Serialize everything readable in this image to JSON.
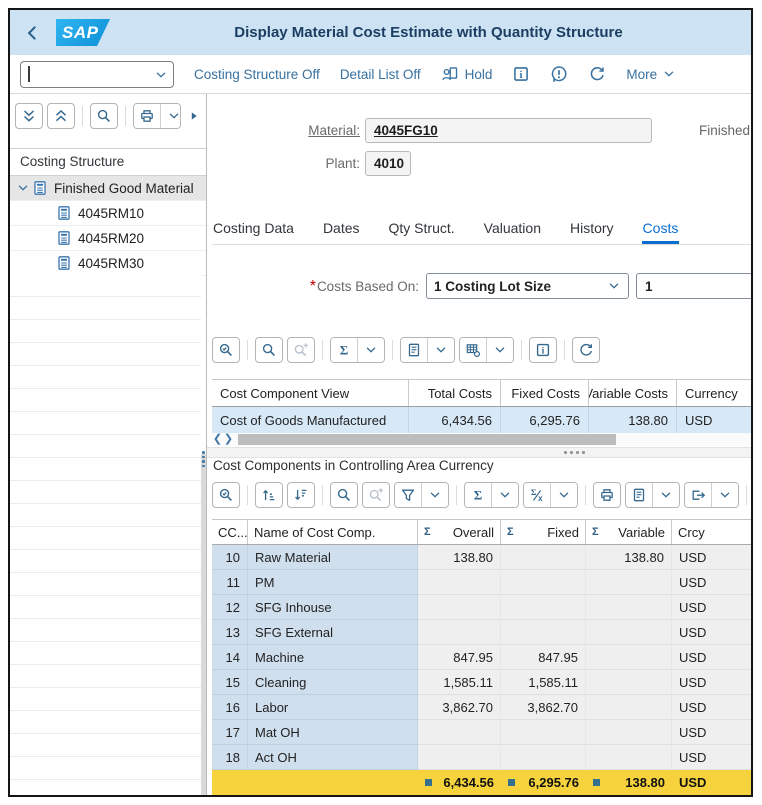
{
  "header": {
    "logo": "SAP",
    "title": "Display Material Cost Estimate with Quantity Structure"
  },
  "shell_toolbar": {
    "command_value": "",
    "costing_structure_btn": "Costing Structure Off",
    "detail_list_btn": "Detail List Off",
    "hold_btn": "Hold",
    "more_btn": "More"
  },
  "left_panel": {
    "header": "Costing Structure",
    "root_label": "Finished Good Material",
    "items": [
      {
        "label": "4045RM10"
      },
      {
        "label": "4045RM20"
      },
      {
        "label": "4045RM30"
      }
    ]
  },
  "detail_header": {
    "material_label": "Material:",
    "material_value": "4045FG10",
    "material_description": "Finished",
    "plant_label": "Plant:",
    "plant_value": "4010"
  },
  "tabs": [
    {
      "label": "Costing Data"
    },
    {
      "label": "Dates"
    },
    {
      "label": "Qty Struct."
    },
    {
      "label": "Valuation"
    },
    {
      "label": "History"
    },
    {
      "label": "Costs"
    }
  ],
  "costs_based_on": {
    "required_mark": "*",
    "label": "Costs Based On:",
    "selected_option": "1 Costing Lot Size",
    "lot_size_value": "1"
  },
  "cost_view_table": {
    "columns": [
      "Cost Component View",
      "Total Costs",
      "Fixed Costs",
      "Variable Costs",
      "Currency"
    ],
    "row": {
      "view": "Cost of Goods Manufactured",
      "total": "6,434.56",
      "fixed": "6,295.76",
      "variable": "138.80",
      "currency": "USD"
    }
  },
  "cost_components": {
    "title": "Cost Components in Controlling Area Currency",
    "sum_symbol": "Σ",
    "columns": {
      "cc": "CC...",
      "name": "Name of Cost Comp.",
      "overall": "Overall",
      "fixed": "Fixed",
      "variable": "Variable",
      "crcy": "Crcy"
    },
    "rows": [
      {
        "cc": "10",
        "name": "Raw Material",
        "overall": "138.80",
        "fixed": "",
        "variable": "138.80",
        "crcy": "USD"
      },
      {
        "cc": "11",
        "name": "PM",
        "overall": "",
        "fixed": "",
        "variable": "",
        "crcy": "USD"
      },
      {
        "cc": "12",
        "name": "SFG Inhouse",
        "overall": "",
        "fixed": "",
        "variable": "",
        "crcy": "USD"
      },
      {
        "cc": "13",
        "name": "SFG External",
        "overall": "",
        "fixed": "",
        "variable": "",
        "crcy": "USD"
      },
      {
        "cc": "14",
        "name": "Machine",
        "overall": "847.95",
        "fixed": "847.95",
        "variable": "",
        "crcy": "USD"
      },
      {
        "cc": "15",
        "name": "Cleaning",
        "overall": "1,585.11",
        "fixed": "1,585.11",
        "variable": "",
        "crcy": "USD"
      },
      {
        "cc": "16",
        "name": "Labor",
        "overall": "3,862.70",
        "fixed": "3,862.70",
        "variable": "",
        "crcy": "USD"
      },
      {
        "cc": "17",
        "name": "Mat OH",
        "overall": "",
        "fixed": "",
        "variable": "",
        "crcy": "USD"
      },
      {
        "cc": "18",
        "name": "Act OH",
        "overall": "",
        "fixed": "",
        "variable": "",
        "crcy": "USD"
      }
    ],
    "totals": {
      "overall": "6,434.56",
      "fixed": "6,295.76",
      "variable": "138.80",
      "crcy": "USD"
    }
  },
  "icons": {
    "back-icon": "chevron-left",
    "search-icon": "magnifier",
    "choose-detail-icon": "magnifier-check",
    "find-next-icon": "magnifier-plus",
    "sum-icon": "sigma",
    "subtotal-icon": "sigma-slash-x",
    "printer-icon": "printer",
    "views-icon": "document-lines",
    "layout-icon": "grid-gear",
    "export-icon": "box-arrow-right",
    "info-icon": "boxed-i",
    "message-icon": "bubble-exclamation",
    "services-icon": "circular-arrow",
    "hold-icon": "person-document",
    "filter-icon": "funnel",
    "sort-asc-icon": "arrow-up-bars",
    "sort-desc-icon": "arrow-down-bars",
    "collapse-all-icon": "double-chevron-down",
    "expand-all-icon": "double-chevron-up",
    "chevron-down-icon": "chevron-down",
    "calculator-icon": "calculator"
  },
  "colors": {
    "titlebar_bg": "#cde3f3",
    "accent_blue": "#0a6ed1",
    "link_blue": "#38719f",
    "icon_blue": "#35688e",
    "selected_row_bg": "#d7e8f7",
    "name_cell_bg": "#cfdfee",
    "value_cell_bg": "#efefef",
    "total_row_bg": "#f6d33c",
    "total_marker": "#35708e",
    "sap_logo_bg": "#0d8fd6"
  }
}
